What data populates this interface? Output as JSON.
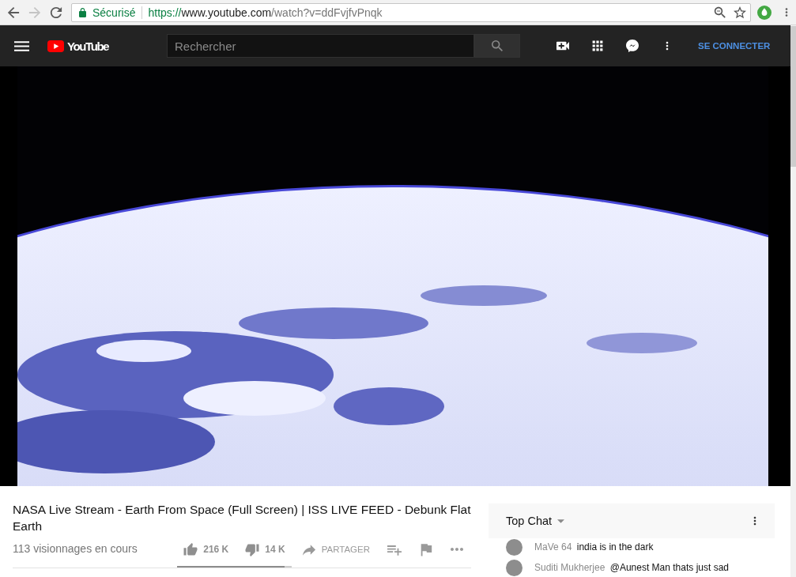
{
  "browser": {
    "nav_buttons": [
      {
        "kind": "back",
        "disabled": false
      },
      {
        "kind": "forward",
        "disabled": true
      },
      {
        "kind": "reload",
        "disabled": false
      }
    ],
    "security_label": "Sécurisé",
    "url": {
      "scheme": "https://",
      "host": "www.youtube.com",
      "path": "/watch?v=ddFvjfvPnqk"
    },
    "omnibox_icons": [
      {
        "kind": "zoom"
      },
      {
        "kind": "bookmark"
      }
    ],
    "toolbar_icons": [
      {
        "kind": "extension"
      },
      {
        "kind": "menu"
      }
    ]
  },
  "header": {
    "logo_text": "YouTube",
    "search": {
      "placeholder": "Rechercher"
    },
    "icons": [
      {
        "kind": "upload"
      },
      {
        "kind": "apps"
      },
      {
        "kind": "messages"
      },
      {
        "kind": "more"
      }
    ],
    "sign_in": "SE CONNECTER"
  },
  "video": {
    "title": "NASA Live Stream - Earth From Space (Full Screen) | ISS LIVE FEED - Debunk Flat Earth",
    "views": "113 visionnages en cours",
    "rating": {
      "buttons": [
        {
          "kind": "like",
          "count": "216 K"
        },
        {
          "kind": "dislike",
          "count": "14 K"
        }
      ],
      "level": 0.94
    },
    "actions": [
      {
        "kind": "share",
        "label": "PARTAGER"
      },
      {
        "kind": "add_to_playlist"
      },
      {
        "kind": "report"
      },
      {
        "kind": "more"
      }
    ]
  },
  "chat": {
    "title": "Top Chat",
    "messages": [
      {
        "author": "MaVe 64",
        "text": "india is in the dark"
      },
      {
        "author": "Suditi Mukherjee",
        "text": "@Aunest Man thats just sad"
      }
    ]
  }
}
